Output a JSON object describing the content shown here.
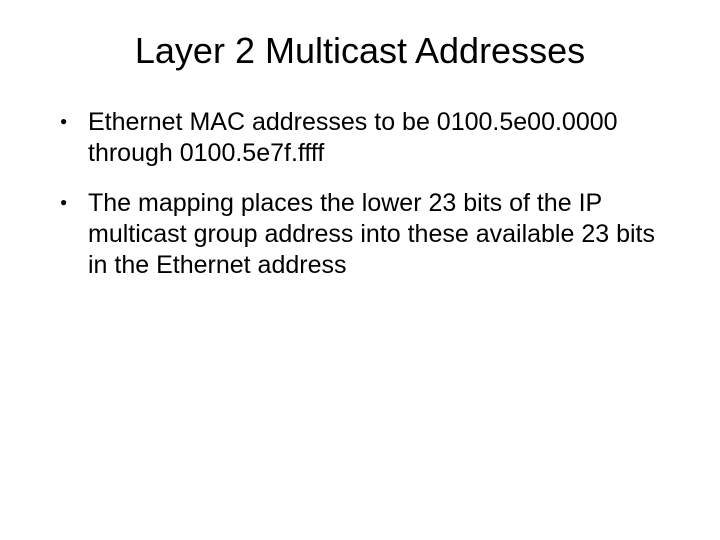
{
  "slide": {
    "title": "Layer 2 Multicast Addresses",
    "bullets": [
      "Ethernet MAC addresses to be 0100.5e00.0000 through 0100.5e7f.ffff",
      "The mapping places the lower 23 bits of the IP multicast group address into these available 23 bits in the Ethernet address"
    ]
  }
}
